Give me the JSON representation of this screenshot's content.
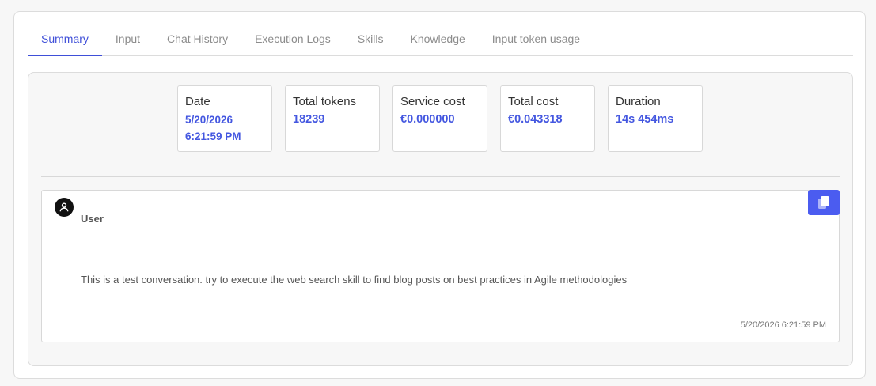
{
  "tabs": [
    {
      "label": "Summary",
      "active": true
    },
    {
      "label": "Input"
    },
    {
      "label": "Chat History"
    },
    {
      "label": "Execution Logs"
    },
    {
      "label": "Skills"
    },
    {
      "label": "Knowledge"
    },
    {
      "label": "Input token usage"
    }
  ],
  "stats": {
    "date": {
      "label": "Date",
      "value_line1": "5/20/2026",
      "value_line2": "6:21:59 PM"
    },
    "total_tokens": {
      "label": "Total tokens",
      "value": "18239"
    },
    "service_cost": {
      "label": "Service cost",
      "value": "€0.000000"
    },
    "total_cost": {
      "label": "Total cost",
      "value": "€0.043318"
    },
    "duration": {
      "label": "Duration",
      "value": "14s 454ms"
    }
  },
  "message": {
    "sender": "User",
    "text": "This is a test conversation. try to execute the web search skill to find blog posts on best practices in Agile methodologies",
    "timestamp": "5/20/2026 6:21:59 PM",
    "avatar_icon": "user-icon",
    "copy_icon": "copy-icon"
  },
  "colors": {
    "accent": "#3f4fd8",
    "value_text": "#4457e0",
    "copy_button": "#4b5cf0"
  }
}
